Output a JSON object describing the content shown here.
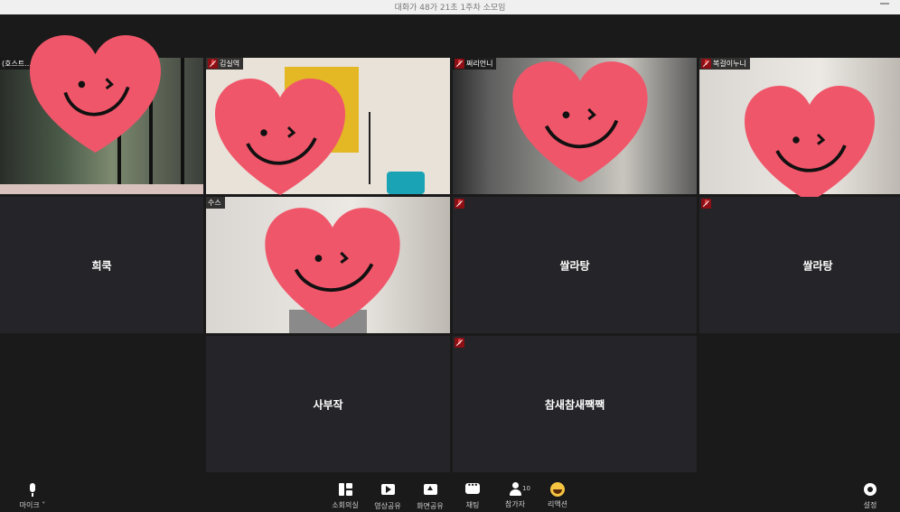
{
  "window": {
    "title": "대화가 48가 21초 1주차 소모임"
  },
  "tiles": {
    "t1": {
      "name": "(호스트..."
    },
    "t2": {
      "name": "김실역"
    },
    "t3": {
      "name": "쩌리언니"
    },
    "t4": {
      "name": "복걸이누니"
    },
    "t5": {
      "name": "희쿡"
    },
    "t6": {
      "name": "수스"
    },
    "t7": {
      "name": "쌀라탕"
    },
    "t8": {
      "name": "쌀라탕"
    },
    "t9": {
      "name": "사부작"
    },
    "t10": {
      "name": "참새참새짹짹"
    }
  },
  "toolbar": {
    "mic": {
      "label": "마이크",
      "icon": "microphone-icon"
    },
    "breakout": {
      "label": "소회의실",
      "icon": "breakout-rooms-icon"
    },
    "video_share": {
      "label": "영상공유",
      "icon": "play-icon"
    },
    "screen_share": {
      "label": "화면공유",
      "icon": "share-screen-icon"
    },
    "chat": {
      "label": "채팅",
      "icon": "chat-icon"
    },
    "participants": {
      "label": "참가자",
      "count": "10",
      "icon": "participants-icon"
    },
    "reaction": {
      "label": "리액션",
      "icon": "emoji-icon"
    },
    "settings": {
      "label": "설정",
      "icon": "gear-icon"
    }
  },
  "colors": {
    "background": "#1a1a1a",
    "tile": "#252529",
    "heart": "#f0566a",
    "muted_mic": "#8b0f14"
  }
}
